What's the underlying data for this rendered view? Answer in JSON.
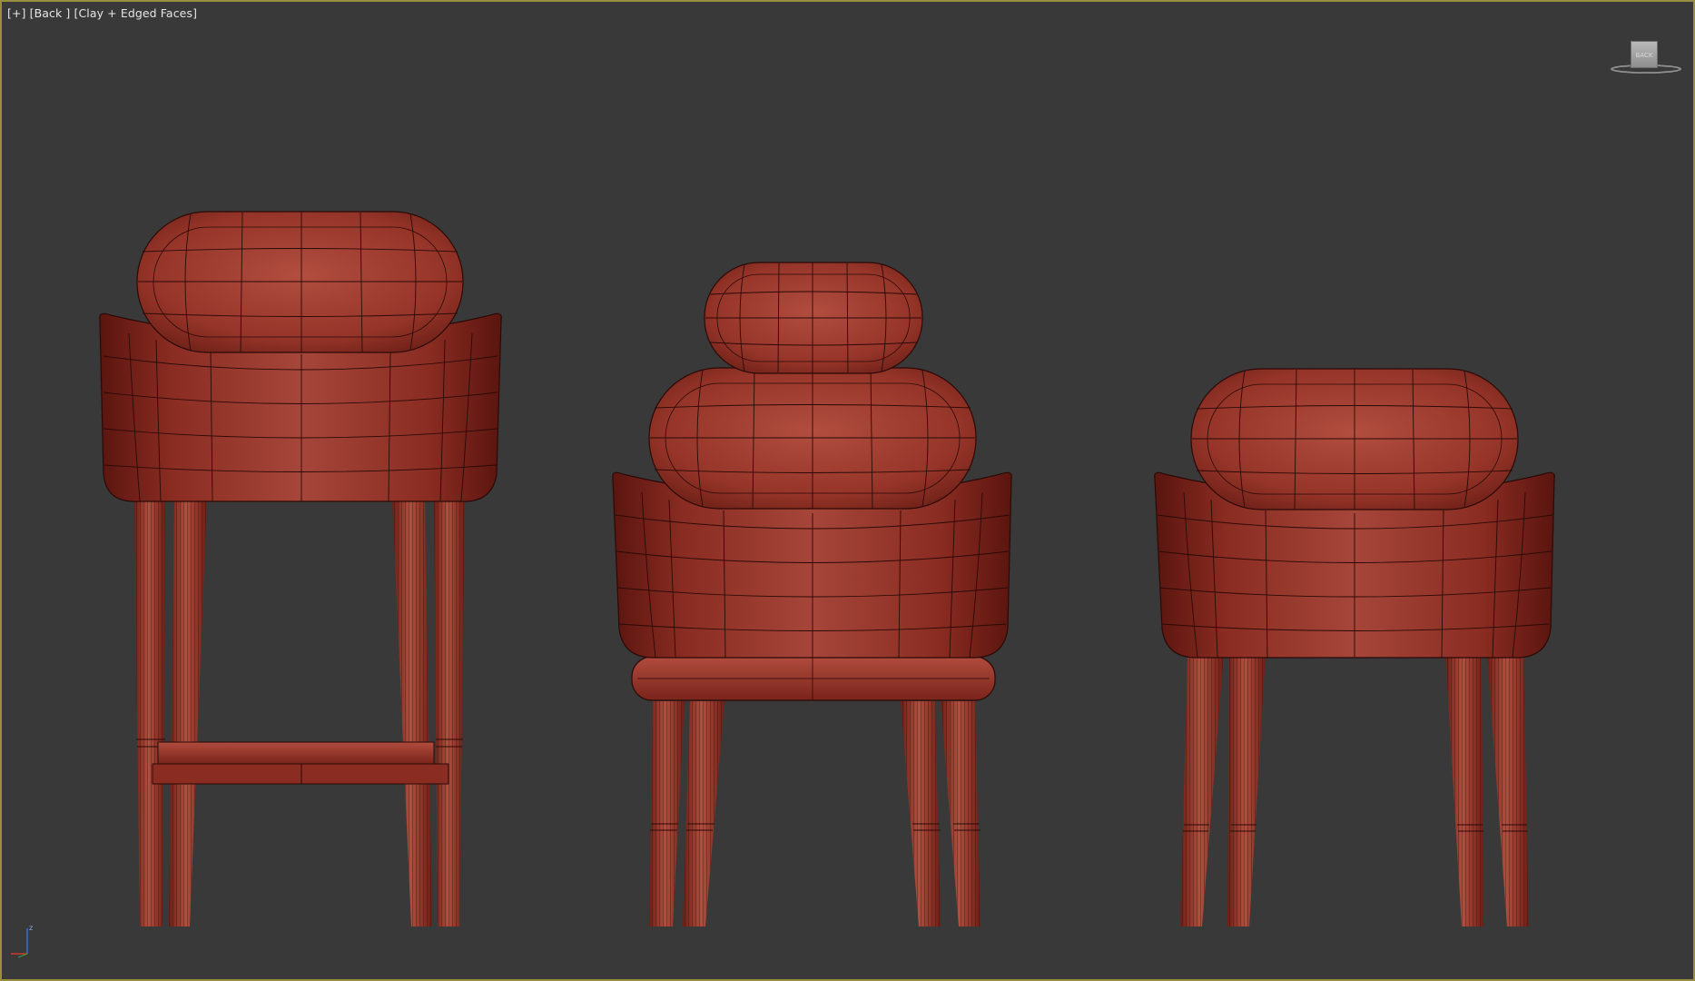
{
  "viewport": {
    "menu_label": "[+]",
    "view_label": "[Back ]",
    "shading_label": "[Clay + Edged Faces]"
  },
  "viewcube": {
    "face_label": "BACK"
  },
  "axis_tripod": {
    "up_axis": "z"
  },
  "colors": {
    "background": "#393939",
    "border": "#9a8f3c",
    "clay": "#8f2f25",
    "clay_highlight": "#b35142",
    "wire": "#2a0a07"
  },
  "scene": {
    "objects": [
      "bar stool",
      "counter stool",
      "dining chair"
    ]
  }
}
